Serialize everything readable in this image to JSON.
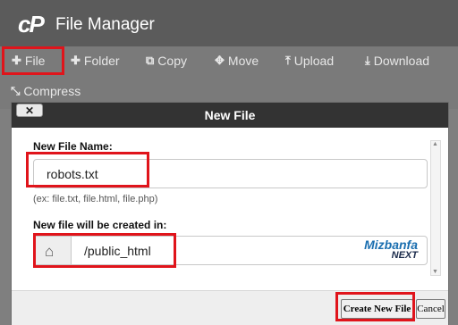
{
  "header": {
    "logo": "cP",
    "title": "File Manager"
  },
  "toolbar": {
    "items": [
      {
        "label": "File",
        "icon": "plus-icon",
        "glyph": "✚"
      },
      {
        "label": "Folder",
        "icon": "plus-icon",
        "glyph": "✚"
      },
      {
        "label": "Copy",
        "icon": "copy-icon",
        "glyph": "⧉"
      },
      {
        "label": "Move",
        "icon": "move-icon",
        "glyph": "✥"
      },
      {
        "label": "Upload",
        "icon": "upload-icon",
        "glyph": "⤒"
      },
      {
        "label": "Download",
        "icon": "download-icon",
        "glyph": "⤓"
      },
      {
        "label": "Compress",
        "icon": "compress-icon",
        "glyph": "⤡"
      }
    ]
  },
  "dialog": {
    "title": "New File",
    "close_label": "✕",
    "file_name_label": "New File Name:",
    "file_name_value": "robots.txt",
    "file_name_hint": "(ex: file.txt, file.html, file.php)",
    "location_label": "New file will be created in:",
    "location_value": "/public_html",
    "location_icon": "home-icon",
    "watermark": {
      "main": "Mizbanfa",
      "sub": "NEXT"
    },
    "create_button": "Create New File",
    "cancel_button": "Cancel"
  },
  "colors": {
    "highlight": "#e0141b",
    "header_bg": "#5b5b5b",
    "toolbar_bg": "#7a7a7a"
  }
}
